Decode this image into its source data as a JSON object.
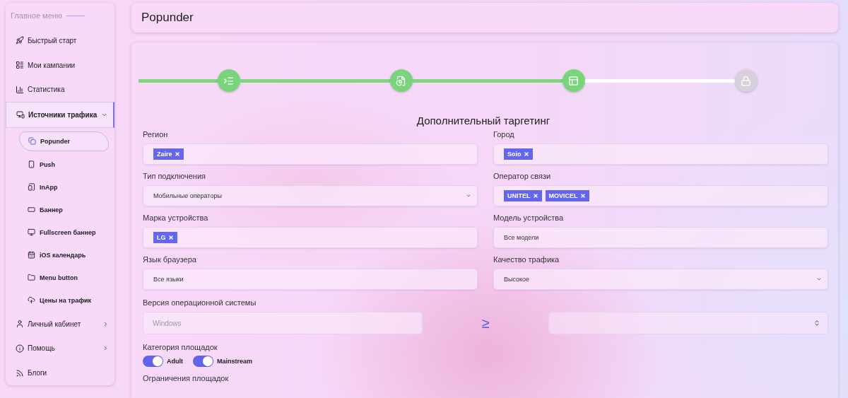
{
  "sidebar": {
    "heading": "Главное меню",
    "items": [
      {
        "label": "Быстрый старт",
        "kind": "link"
      },
      {
        "label": "Мои кампании",
        "kind": "link"
      },
      {
        "label": "Статистика",
        "kind": "link"
      },
      {
        "label": "Источники трафика",
        "kind": "group",
        "expanded": true,
        "children": [
          {
            "label": "Popunder",
            "selected": true
          },
          {
            "label": "Push",
            "selected": false
          },
          {
            "label": "InApp",
            "selected": false
          },
          {
            "label": "Баннер",
            "selected": false
          },
          {
            "label": "Fullscreen баннер",
            "selected": false
          },
          {
            "label": "iOS календарь",
            "selected": false
          },
          {
            "label": "Menu button",
            "selected": false
          },
          {
            "label": "Цены на трафик",
            "selected": false
          }
        ]
      },
      {
        "label": "Личный кабинет",
        "kind": "group",
        "expanded": false
      },
      {
        "label": "Помощь",
        "kind": "group",
        "expanded": false
      },
      {
        "label": "Блоги",
        "kind": "link"
      }
    ]
  },
  "page_title": "Popunder",
  "steps": [
    {
      "done": true
    },
    {
      "done": true
    },
    {
      "done": true
    },
    {
      "done": false
    }
  ],
  "section_title": "Дополнительный таргетинг",
  "fields": [
    {
      "label": "Регион",
      "kind": "tags",
      "tags": [
        "Zaire"
      ]
    },
    {
      "label": "Город",
      "kind": "tags",
      "tags": [
        "Soio"
      ]
    },
    {
      "label": "Тип подключения",
      "kind": "select",
      "value": "Мобильные операторы"
    },
    {
      "label": "Оператор связи",
      "kind": "tags",
      "tags": [
        "UNITEL",
        "MOVICEL"
      ]
    },
    {
      "label": "Марка устройства",
      "kind": "tags",
      "tags": [
        "LG"
      ]
    },
    {
      "label": "Модель устройства",
      "kind": "text",
      "value": "Все модели"
    },
    {
      "label": "Язык браузера",
      "kind": "text",
      "value": "Все языки"
    },
    {
      "label": "Качество трафика",
      "kind": "select",
      "value": "Высокое"
    }
  ],
  "os_version": {
    "label": "Версия операционной системы",
    "placeholder": "Windows",
    "operator": "≥"
  },
  "categories": {
    "label": "Категория площадок",
    "toggles": [
      {
        "label": "Adult",
        "on": true
      },
      {
        "label": "Mainstream",
        "on": true
      }
    ]
  },
  "restrictions_label": "Ограничения площадок"
}
